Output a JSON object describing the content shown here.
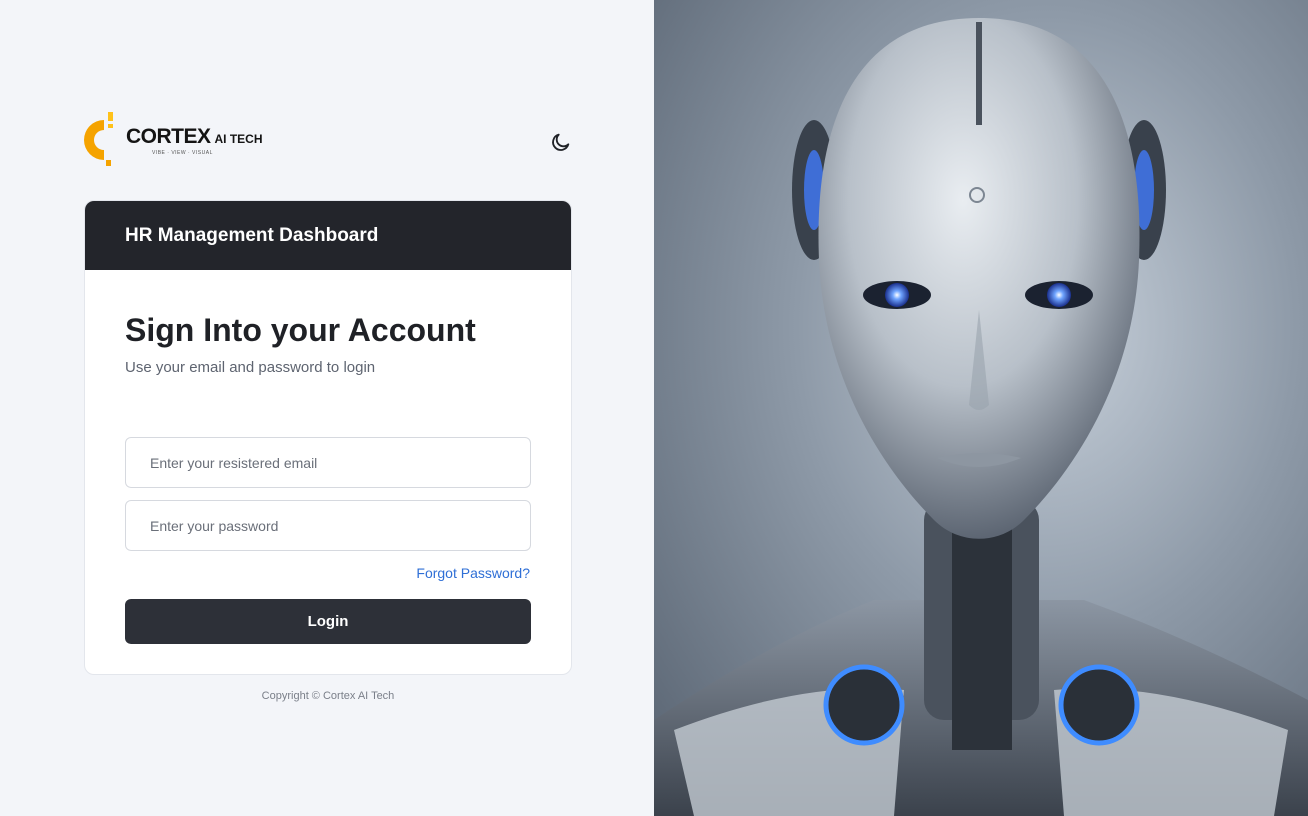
{
  "brand": {
    "name": "CORTEX",
    "suffix": "AI TECH",
    "tagline": "VIBE · VIEW · VISUAL",
    "colors": {
      "mark_primary": "#f5a300",
      "mark_secondary": "#ffc21a",
      "text": "#141414"
    }
  },
  "theme_toggle": {
    "icon": "moon-icon"
  },
  "card": {
    "header_title": "HR Management Dashboard",
    "title": "Sign Into your Account",
    "subtitle": "Use your email and password to login",
    "email": {
      "placeholder": "Enter your resistered email",
      "value": ""
    },
    "password": {
      "placeholder": "Enter your password",
      "value": ""
    },
    "forgot_link": "Forgot Password?",
    "login_button": "Login"
  },
  "footer": {
    "copyright": "Copyright © Cortex AI Tech"
  },
  "hero": {
    "image": "robot-portrait"
  },
  "colors": {
    "header_bg": "#23252b",
    "button_bg": "#2d3038",
    "link": "#2f6fd6",
    "page_bg": "#f3f5f9"
  }
}
